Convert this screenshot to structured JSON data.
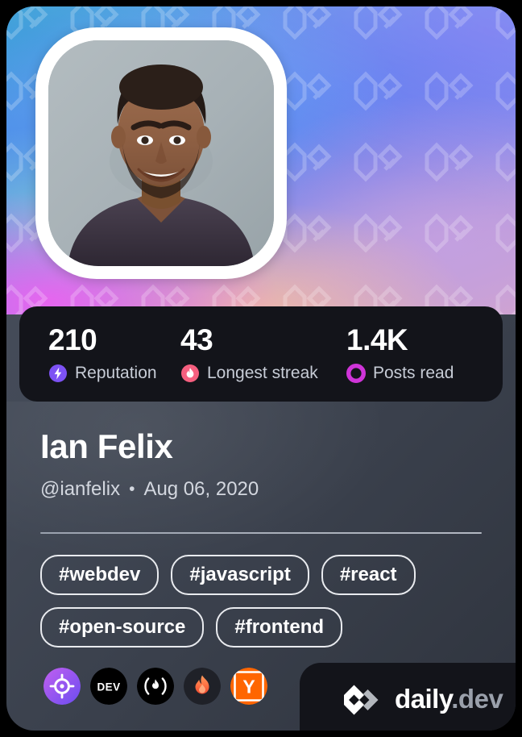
{
  "card": {
    "cover": {
      "avatar_alt": "Ian Felix profile photo",
      "pattern_icon": "daily-dev-logo-watermark"
    },
    "stats": [
      {
        "value": "210",
        "label": "Reputation",
        "icon": "reputation-bolt-icon",
        "color": "#7d52f4"
      },
      {
        "value": "43",
        "label": "Longest streak",
        "icon": "streak-flame-icon",
        "color": "#f65f7f"
      },
      {
        "value": "1.4K",
        "label": "Posts read",
        "icon": "posts-read-ring-icon",
        "color": "#cf34d8"
      }
    ],
    "profile": {
      "name": "Ian Felix",
      "handle": "@ianfelix",
      "separator": "•",
      "joined_date": "Aug 06, 2020"
    },
    "tags": [
      "#webdev",
      "#javascript",
      "#react",
      "#open-source",
      "#frontend"
    ],
    "sources": [
      {
        "name": "daily-dev-source-icon",
        "title": "daily.dev"
      },
      {
        "name": "devto-source-icon",
        "title": "DEV"
      },
      {
        "name": "hashnode-source-icon",
        "title": "Hashnode"
      },
      {
        "name": "flame-source-icon",
        "title": "Flame"
      },
      {
        "name": "hackernews-source-icon",
        "title": "Y"
      }
    ],
    "branding": {
      "mark": "daily-dev-logo-mark",
      "name": "daily",
      "suffix": ".dev"
    }
  }
}
